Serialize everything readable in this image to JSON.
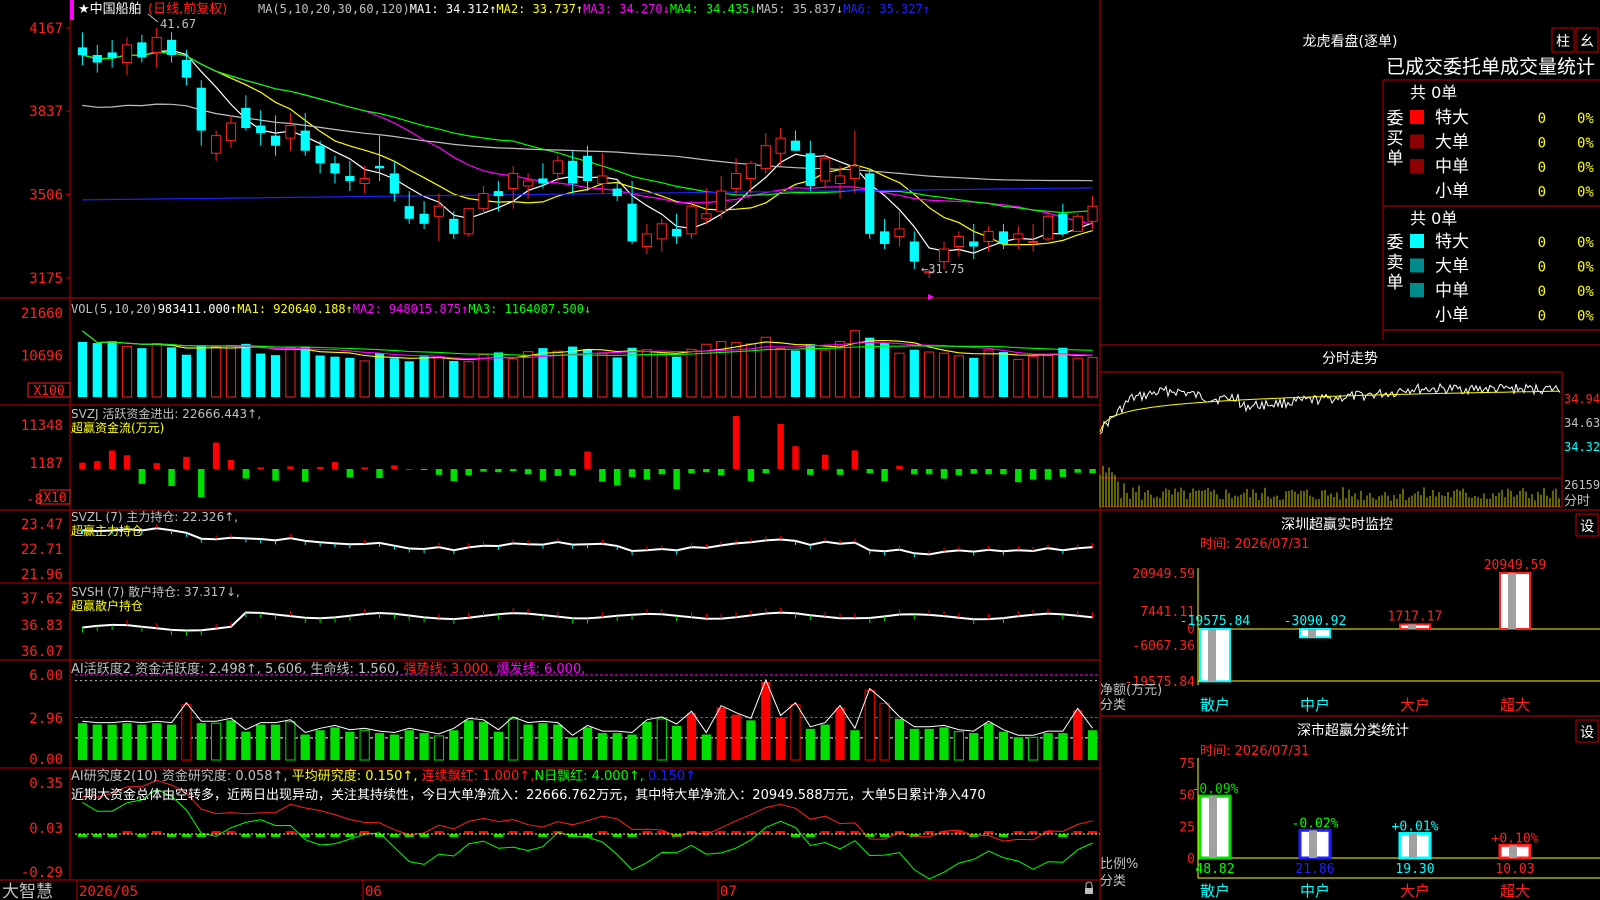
{
  "colors": {
    "up": "#ff2020",
    "down": "#00ffff",
    "frame": "#c00000",
    "vol_up": "#ff2020",
    "ma1": "#ffffff",
    "ma2": "#ffff00",
    "ma3": "#ff00ff",
    "ma4": "#00ff00",
    "ma5": "#c0c0c0",
    "ma6": "#2020ff",
    "bar_green": "#00e000",
    "bar_red": "#ff0000"
  },
  "header": {
    "stock": "★中国船舶",
    "period": "(日线,前复权)",
    "ma_items": [
      {
        "t": "MA(5,10,20,30,60,120)",
        "c": "#c0c0c0"
      },
      {
        "t": "MA1: 34.312↑",
        "c": "#ffffff"
      },
      {
        "t": "MA2: 33.737↑",
        "c": "#ffff00"
      },
      {
        "t": "MA3: 34.270↓",
        "c": "#ff00ff"
      },
      {
        "t": "MA4: 34.435↓",
        "c": "#00ff00"
      },
      {
        "t": "MA5: 35.837↓",
        "c": "#c0c0c0"
      },
      {
        "t": "MA6: 35.327↑",
        "c": "#2020ff"
      }
    ]
  },
  "price_axis": {
    "labels": [
      "4167",
      "3837",
      "3506",
      "3175"
    ]
  },
  "annotations": {
    "high": "41.67",
    "low": "←31.75"
  },
  "vol_panel": {
    "items": [
      {
        "t": "VOL(5,10,20)",
        "c": "#c0c0c0"
      },
      {
        "t": "983411.000↑",
        "c": "#ffffff"
      },
      {
        "t": "MA1: 920640.188↑",
        "c": "#ffff00"
      },
      {
        "t": "MA2: 948015.875↑",
        "c": "#ff00ff"
      },
      {
        "t": "MA3: 1164087.500↓",
        "c": "#00ff00"
      }
    ],
    "axis": [
      "21660",
      "10696"
    ],
    "unit": "X100"
  },
  "svzj_panel": {
    "line1": "SVZJ  活跃资金进出: 22666.443↑,",
    "line2": "超赢资金流(万元)",
    "axis": [
      "11348",
      "1187",
      "-8"
    ],
    "unit": "X10"
  },
  "svzl_panel": {
    "line1": "SVZL (7) 主力持仓: 22.326↑,",
    "line2": "超赢主力持仓",
    "axis": [
      "23.47",
      "22.71",
      "21.96"
    ]
  },
  "svsh_panel": {
    "line1": "SVSH (7) 散户持仓: 37.317↓,",
    "line2": "超赢散户持仓",
    "axis": [
      "37.62",
      "36.83",
      "36.07"
    ]
  },
  "ai_act_panel": {
    "items": [
      {
        "t": "AI活跃度2 资金活跃度: 2.498↑, 5.606, 生命线: 1.560, ",
        "c": "#c0c0c0"
      },
      {
        "t": "强势线: 3.000, ",
        "c": "#ff2020"
      },
      {
        "t": "爆发线: 6.000,",
        "c": "#ff00ff"
      }
    ],
    "axis": [
      "6.00",
      "2.96",
      "0.00"
    ]
  },
  "ai_res_panel": {
    "items": [
      {
        "t": "AI研究度2(10) 资金研究度: 0.058↑, ",
        "c": "#c0c0c0"
      },
      {
        "t": "平均研究度: 0.150↑,",
        "c": "#ffff00"
      },
      {
        "t": " 连续飘红: 1.000↑,",
        "c": "#ff2020"
      },
      {
        "t": "N日飘红: 4.000↑,",
        "c": "#00ff00"
      },
      {
        "t": " 0.150↑",
        "c": "#2020ff"
      }
    ],
    "comment": "近期大资金总体由空转多，近两日出现异动，关注其持续性，今日大单净流入：22666.762万元，其中特大单净流入：20949.588万元，大单5日累计净入470",
    "axis": [
      "0.35",
      "0.03",
      "-0.29"
    ]
  },
  "bottom": {
    "brand": "大智慧",
    "dates": [
      "2026/05",
      "06",
      "07"
    ]
  },
  "lhb": {
    "title": "龙虎看盘(逐单)",
    "btn1": "柱",
    "btn2": "幺",
    "subtitle": "已成交委托单成交量统计",
    "buy_label": "委买单",
    "sell_label": "委卖单",
    "buy_total": "共 0单",
    "sell_total": "共 0单",
    "buy_rows": [
      {
        "name": "特大",
        "v": "0",
        "p": "0%",
        "c": "#ff0000"
      },
      {
        "name": "大单",
        "v": "0",
        "p": "0%",
        "c": "#8b0000"
      },
      {
        "name": "中单",
        "v": "0",
        "p": "0%",
        "c": "#8b0000"
      },
      {
        "name": "小单",
        "v": "0",
        "p": "0%",
        "c": "#000000"
      }
    ],
    "sell_rows": [
      {
        "name": "特大",
        "v": "0",
        "p": "0%",
        "c": "#00ffff"
      },
      {
        "name": "大单",
        "v": "0",
        "p": "0%",
        "c": "#008b8b"
      },
      {
        "name": "中单",
        "v": "0",
        "p": "0%",
        "c": "#008b8b"
      },
      {
        "name": "小单",
        "v": "0",
        "p": "0%",
        "c": "#000000"
      }
    ]
  },
  "fenshi": {
    "title": "分时走势",
    "axis": [
      "34.94",
      "34.63",
      "34.32"
    ],
    "vol_label": "26159",
    "vol_unit": "分时"
  },
  "monitor": {
    "title": "深圳超赢实时监控",
    "btn": "设",
    "time": "时间: 2026/07/31",
    "axis": [
      "20949.59",
      "7441.11",
      "0",
      "-6067.36",
      "-19575.84"
    ],
    "ylabel": "净额(万元)",
    "xlabel": "分类",
    "cats": [
      "散户",
      "中户",
      "大户",
      "超大"
    ],
    "values": [
      -19575.84,
      -3090.92,
      1717.17,
      20949.59
    ],
    "value_labels": [
      "-19575.84",
      "-3090.92",
      "1717.17",
      "20949.59"
    ]
  },
  "classify": {
    "title": "深市超赢分类统计",
    "btn": "设",
    "time": "时间: 2026/07/31",
    "axis": [
      "75",
      "50",
      "25",
      "0"
    ],
    "ylabel": "比例%",
    "xlabel": "分类",
    "cats": [
      "散户",
      "中户",
      "大户",
      "超大"
    ],
    "values": [
      48.82,
      21.86,
      19.3,
      10.03
    ],
    "value_labels": [
      "48.82",
      "21.86",
      "19.30",
      "10.03"
    ],
    "changes": [
      "-0.09%",
      "-0.02%",
      "+0.01%",
      "+0.10%"
    ]
  },
  "chart_data": [
    {
      "type": "candlestick",
      "title": "中国船舶 (日线,前复权)",
      "y_ticks": [
        41.67,
        38.37,
        35.06,
        31.75
      ],
      "high": 41.67,
      "low": 31.75,
      "ma": {
        "MA1": 34.312,
        "MA2": 33.737,
        "MA3": 34.27,
        "MA4": 34.435,
        "MA5": 35.837,
        "MA6": 35.327
      },
      "ohlc": [
        [
          40.9,
          41.5,
          40.2,
          40.6
        ],
        [
          40.6,
          41.0,
          39.9,
          40.3
        ],
        [
          40.7,
          41.2,
          40.1,
          40.5
        ],
        [
          40.3,
          41.3,
          39.8,
          41.0
        ],
        [
          41.1,
          41.4,
          40.3,
          40.5
        ],
        [
          40.7,
          41.67,
          40.1,
          41.3
        ],
        [
          41.2,
          41.5,
          40.3,
          40.6
        ],
        [
          40.4,
          40.8,
          39.4,
          39.7
        ],
        [
          39.3,
          39.6,
          37.0,
          37.6
        ],
        [
          36.7,
          37.6,
          36.4,
          37.4
        ],
        [
          37.2,
          38.2,
          36.9,
          37.9
        ],
        [
          38.5,
          39.0,
          37.6,
          37.7
        ],
        [
          37.8,
          38.4,
          37.0,
          37.5
        ],
        [
          37.4,
          38.2,
          36.6,
          37.0
        ],
        [
          37.3,
          38.3,
          36.8,
          37.8
        ],
        [
          37.6,
          38.3,
          36.6,
          36.8
        ],
        [
          37.0,
          37.2,
          35.9,
          36.3
        ],
        [
          36.3,
          36.6,
          35.5,
          35.9
        ],
        [
          35.8,
          36.4,
          35.2,
          35.6
        ],
        [
          35.5,
          36.2,
          35.1,
          35.7
        ],
        [
          36.2,
          37.4,
          35.6,
          36.1
        ],
        [
          35.9,
          36.4,
          34.8,
          35.1
        ],
        [
          34.6,
          35.2,
          33.9,
          34.1
        ],
        [
          34.3,
          34.8,
          33.7,
          33.9
        ],
        [
          34.2,
          35.1,
          33.2,
          34.6
        ],
        [
          34.1,
          34.4,
          33.3,
          33.5
        ],
        [
          33.5,
          34.5,
          33.4,
          34.5
        ],
        [
          34.5,
          35.4,
          34.3,
          35.1
        ],
        [
          35.2,
          35.6,
          34.4,
          35.0
        ],
        [
          35.3,
          36.2,
          34.5,
          35.9
        ],
        [
          35.4,
          35.9,
          34.9,
          35.6
        ],
        [
          35.7,
          36.3,
          35.3,
          35.5
        ],
        [
          35.9,
          36.6,
          35.6,
          36.4
        ],
        [
          36.4,
          36.8,
          35.1,
          35.5
        ],
        [
          36.6,
          37.0,
          35.2,
          35.6
        ],
        [
          35.5,
          36.7,
          35.1,
          35.8
        ],
        [
          35.3,
          35.6,
          34.8,
          35.0
        ],
        [
          34.7,
          35.6,
          33.1,
          33.2
        ],
        [
          33.0,
          33.9,
          32.7,
          33.5
        ],
        [
          33.3,
          34.1,
          32.8,
          33.9
        ],
        [
          33.7,
          34.3,
          33.1,
          33.4
        ],
        [
          33.5,
          34.8,
          33.3,
          34.6
        ],
        [
          34.1,
          35.3,
          33.9,
          34.3
        ],
        [
          34.4,
          35.8,
          34.1,
          35.2
        ],
        [
          35.3,
          36.5,
          35.0,
          35.9
        ],
        [
          35.7,
          36.4,
          35.1,
          36.3
        ],
        [
          36.1,
          37.5,
          35.9,
          37.0
        ],
        [
          36.7,
          37.7,
          36.2,
          37.3
        ],
        [
          37.2,
          37.6,
          36.8,
          36.8
        ],
        [
          36.7,
          37.2,
          35.2,
          35.4
        ],
        [
          35.6,
          36.7,
          35.3,
          36.5
        ],
        [
          35.5,
          36.2,
          34.9,
          35.8
        ],
        [
          35.7,
          37.6,
          35.1,
          36.2
        ],
        [
          35.9,
          36.1,
          33.3,
          33.5
        ],
        [
          33.6,
          34.1,
          32.9,
          33.1
        ],
        [
          33.4,
          34.4,
          33.0,
          33.7
        ],
        [
          33.2,
          33.6,
          32.1,
          32.4
        ],
        [
          31.95,
          32.1,
          31.75,
          32.0
        ],
        [
          32.4,
          33.2,
          32.1,
          32.9
        ],
        [
          33.0,
          33.6,
          32.6,
          33.4
        ],
        [
          33.2,
          33.9,
          32.5,
          33.0
        ],
        [
          33.2,
          33.8,
          32.8,
          33.6
        ],
        [
          33.6,
          33.9,
          32.9,
          33.1
        ],
        [
          33.3,
          33.8,
          32.9,
          33.5
        ],
        [
          33.2,
          33.9,
          32.8,
          33.2
        ],
        [
          33.3,
          34.4,
          33.2,
          34.2
        ],
        [
          34.3,
          34.7,
          33.4,
          33.5
        ],
        [
          33.6,
          34.3,
          33.6,
          34.2
        ],
        [
          34.0,
          35.0,
          33.7,
          34.6
        ]
      ]
    },
    {
      "type": "bar",
      "title": "VOL(5,10,20)",
      "y_ticks": [
        21660,
        10696
      ],
      "unit": "X100",
      "values_x100": [
        14200,
        13900,
        14400,
        13000,
        12600,
        13800,
        12800,
        10900,
        13200,
        12900,
        13300,
        13700,
        11200,
        10800,
        12700,
        13000,
        10700,
        10400,
        10100,
        9300,
        11300,
        10000,
        9200,
        10500,
        10100,
        9300,
        9100,
        10900,
        11500,
        9800,
        11700,
        12600,
        11800,
        13000,
        12300,
        11200,
        10200,
        12700,
        12200,
        10900,
        10400,
        12300,
        13600,
        14300,
        14000,
        13700,
        15400,
        12500,
        12000,
        13600,
        12100,
        14300,
        17100,
        15300,
        14000,
        11300,
        12200,
        11600,
        11300,
        10600,
        10100,
        12100,
        11600,
        9700,
        10400,
        10700,
        12700,
        10000,
        10200
      ],
      "MA1": 920640.188,
      "MA2": 948015.875,
      "MA3": 1164087.5
    },
    {
      "type": "bar",
      "title": "SVZJ 活跃资金进出",
      "y_ticks": [
        11348,
        1187,
        -8
      ],
      "unit": "X10",
      "latest": 22666.443,
      "values": [
        120,
        150,
        350,
        260,
        -280,
        110,
        -320,
        230,
        -530,
        500,
        170,
        -180,
        30,
        -220,
        50,
        -240,
        40,
        130,
        -160,
        30,
        -170,
        70,
        0,
        -20,
        -110,
        -230,
        -120,
        -50,
        -60,
        -40,
        -100,
        -220,
        -130,
        -120,
        330,
        -240,
        -310,
        -150,
        -200,
        -100,
        -380,
        -80,
        -60,
        -120,
        1000,
        -230,
        -80,
        850,
        430,
        -110,
        270,
        -110,
        350,
        -80,
        -230,
        60,
        -100,
        -100,
        -180,
        -120,
        -90,
        -100,
        -100,
        -250,
        -200,
        -200,
        -150,
        -70,
        -80
      ],
      "values_scale_note": "unit X10"
    },
    {
      "type": "line",
      "title": "SVZL (7) 主力持仓",
      "y_ticks": [
        23.47,
        22.71,
        21.96
      ],
      "latest": 22.326
    },
    {
      "type": "line",
      "title": "SVSH (7) 散户持仓",
      "y_ticks": [
        37.62,
        36.83,
        36.07
      ],
      "latest": 37.317
    },
    {
      "type": "bar",
      "title": "AI活跃度2",
      "y_ticks": [
        6.0,
        2.96,
        0.0
      ],
      "资金活跃度": 2.498,
      "生命线": 1.56,
      "强势线": 3.0,
      "爆发线": 6.0,
      "values": [
        2.6,
        2.5,
        2.5,
        2.6,
        2.5,
        2.6,
        2.5,
        3.9,
        2.6,
        2.6,
        2.8,
        2.0,
        2.5,
        2.5,
        2.7,
        1.8,
        2.1,
        2.3,
        2.0,
        2.1,
        1.9,
        1.8,
        2.1,
        1.9,
        1.7,
        2.1,
        2.8,
        2.7,
        2.0,
        2.9,
        2.5,
        2.6,
        2.5,
        1.6,
        2.3,
        1.9,
        1.9,
        1.8,
        2.7,
        2.9,
        2.4,
        3.3,
        1.8,
        3.7,
        3.2,
        2.8,
        5.5,
        3.0,
        3.9,
        2.2,
        2.5,
        3.7,
        2.1,
        4.9,
        4.0,
        2.9,
        2.2,
        2.2,
        2.3,
        2.0,
        1.9,
        2.6,
        2.0,
        1.6,
        1.6,
        1.9,
        1.9,
        3.5,
        2.1,
        2.4
      ]
    },
    {
      "type": "bar",
      "title": "AI研究度2(10)",
      "y_ticks": [
        0.35,
        0.03,
        -0.29
      ],
      "资金研究度": 0.058,
      "平均研究度": 0.15,
      "连续飘红": 1.0,
      "N日飘红": 4.0
    },
    {
      "type": "bar",
      "title": "深圳超赢实时监控",
      "ylabel": "净额(万元)",
      "categories": [
        "散户",
        "中户",
        "大户",
        "超大"
      ],
      "values": [
        -19575.84,
        -3090.92,
        1717.17,
        20949.59
      ]
    },
    {
      "type": "bar",
      "title": "深市超赢分类统计",
      "ylabel": "比例%",
      "categories": [
        "散户",
        "中户",
        "大户",
        "超大"
      ],
      "values": [
        48.82,
        21.86,
        19.3,
        10.03
      ],
      "changes": [
        "-0.09%",
        "-0.02%",
        "+0.01%",
        "+0.10%"
      ]
    }
  ]
}
